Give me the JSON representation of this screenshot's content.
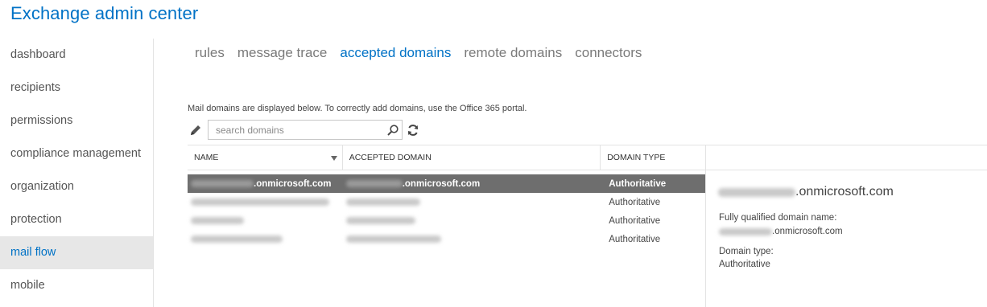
{
  "app": {
    "title": "Exchange admin center"
  },
  "sidebar": {
    "items": [
      {
        "label": "dashboard"
      },
      {
        "label": "recipients"
      },
      {
        "label": "permissions"
      },
      {
        "label": "compliance management"
      },
      {
        "label": "organization"
      },
      {
        "label": "protection"
      },
      {
        "label": "mail flow",
        "active": true
      },
      {
        "label": "mobile"
      }
    ]
  },
  "tabs": [
    {
      "label": "rules"
    },
    {
      "label": "message trace"
    },
    {
      "label": "accepted domains",
      "active": true
    },
    {
      "label": "remote domains"
    },
    {
      "label": "connectors"
    }
  ],
  "info_text": "Mail domains are displayed below. To correctly add domains, use the Office 365 portal.",
  "toolbar": {
    "edit_icon": "pencil-icon",
    "search_placeholder": "search domains",
    "search_icon": "search-icon",
    "refresh_icon": "refresh-icon"
  },
  "grid": {
    "columns": [
      "NAME",
      "ACCEPTED DOMAIN",
      "DOMAIN TYPE"
    ],
    "rows": [
      {
        "name_suffix": ".onmicrosoft.com",
        "domain_suffix": ".onmicrosoft.com",
        "type": "Authoritative",
        "selected": true
      },
      {
        "name_suffix": "",
        "domain_suffix": "",
        "type": "Authoritative"
      },
      {
        "name_suffix": "",
        "domain_suffix": "",
        "type": "Authoritative"
      },
      {
        "name_suffix": "",
        "domain_suffix": "",
        "type": "Authoritative"
      }
    ]
  },
  "details": {
    "title_suffix": ".onmicrosoft.com",
    "fqdn_label": "Fully qualified domain name:",
    "fqdn_suffix": ".onmicrosoft.com",
    "type_label": "Domain type:",
    "type_value": "Authoritative"
  },
  "colors": {
    "accent": "#0072c6",
    "selected_row": "#6e6e6e",
    "active_nav_bg": "#e7e7e7"
  }
}
